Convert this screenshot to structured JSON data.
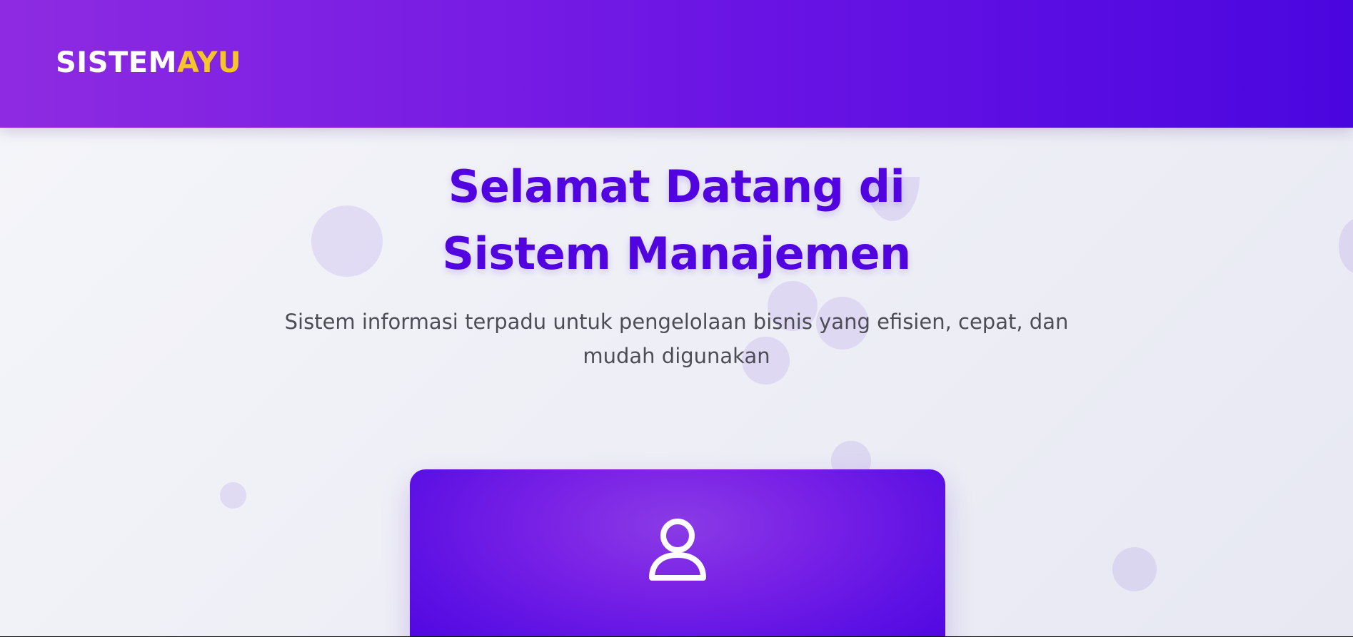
{
  "header": {
    "logo": {
      "part_a": "SISTEM",
      "part_b": "AYU"
    }
  },
  "hero": {
    "title": "Selamat Datang di Sistem Manajemen",
    "subtitle": "Sistem informasi terpadu untuk pengelolaan bisnis yang efisien, cepat, dan mudah digunakan"
  },
  "card": {
    "icon": "user-icon"
  },
  "colors": {
    "brand_purple": "#5104df",
    "header_start": "#8e2be2",
    "header_end": "#4a06df",
    "logo_accent": "#f6c42b"
  }
}
